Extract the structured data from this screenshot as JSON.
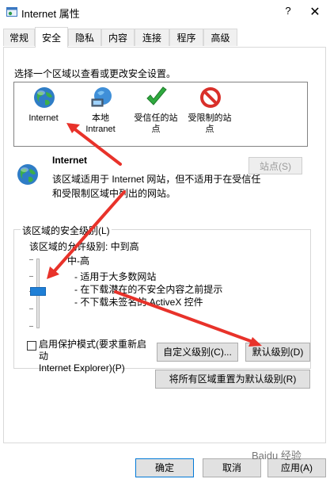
{
  "window": {
    "title": "Internet 属性",
    "help_label": "?",
    "close_label": "✕"
  },
  "tabs": [
    {
      "label": "常规"
    },
    {
      "label": "安全"
    },
    {
      "label": "隐私"
    },
    {
      "label": "内容"
    },
    {
      "label": "连接"
    },
    {
      "label": "程序"
    },
    {
      "label": "高级"
    }
  ],
  "active_tab": "安全",
  "security": {
    "zone_prompt": "选择一个区域以查看或更改安全设置。",
    "zones": [
      {
        "label": "Internet",
        "icon": "globe-icon"
      },
      {
        "label": "本地\nIntranet",
        "icon": "intranet-icon"
      },
      {
        "label": "受信任的站\n点",
        "icon": "checkmark-icon"
      },
      {
        "label": "受限制的站\n点",
        "icon": "no-entry-icon"
      }
    ],
    "selected_zone_title": "Internet",
    "sites_button": "站点(S)",
    "description_line1": "该区域适用于 Internet 网站，但不适用于在受信任",
    "description_line2": "和受限制区域中列出的网站。",
    "group_label": "该区域的安全级别(L)",
    "allowed_level": "该区域的允许级别: 中到高",
    "level_name": "中-高",
    "bullets": [
      "- 适用于大多数网站",
      "- 在下载潜在的不安全内容之前提示",
      "- 不下载未签名的 ActiveX 控件"
    ],
    "protected_mode_line1": "启用保护模式(要求重新启动",
    "protected_mode_line2": "Internet Explorer)(P)",
    "protected_mode_checked": false,
    "custom_level_button": "自定义级别(C)...",
    "default_level_button": "默认级别(D)",
    "reset_all_button": "将所有区域重置为默认级别(R)"
  },
  "footer": {
    "ok": "确定",
    "cancel": "取消",
    "apply": "应用(A)"
  },
  "watermark": "Baidu 经验",
  "colors": {
    "annotation_arrow": "#e8322a",
    "slider_thumb": "#1f7fd6",
    "focus_border": "#0078d7"
  }
}
